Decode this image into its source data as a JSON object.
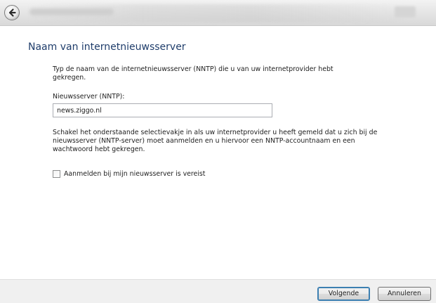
{
  "titlebar": {
    "back_icon": "back-arrow-icon"
  },
  "page": {
    "title": "Naam van internetnieuwsserver",
    "intro": "Typ de naam van de internetnieuwsserver (NNTP) die u van uw internetprovider hebt gekregen.",
    "server_label": "Nieuwsserver (NNTP):",
    "server_value": "news.ziggo.nl",
    "explanation": "Schakel het onderstaande selectievakje in als uw internetprovider u heeft gemeld dat u zich bij de nieuwsserver (NNTP-server) moet aanmelden en u hiervoor een NNTP-accountnaam en een wachtwoord hebt gekregen.",
    "checkbox_label": "Aanmelden bij mijn nieuwsserver is vereist",
    "checkbox_checked": false
  },
  "footer": {
    "next_label": "Volgende",
    "cancel_label": "Annuleren"
  },
  "colors": {
    "title": "#1f3d6b",
    "footer_bg": "#f0f0f0",
    "default_button_border": "#3c7fb1"
  }
}
